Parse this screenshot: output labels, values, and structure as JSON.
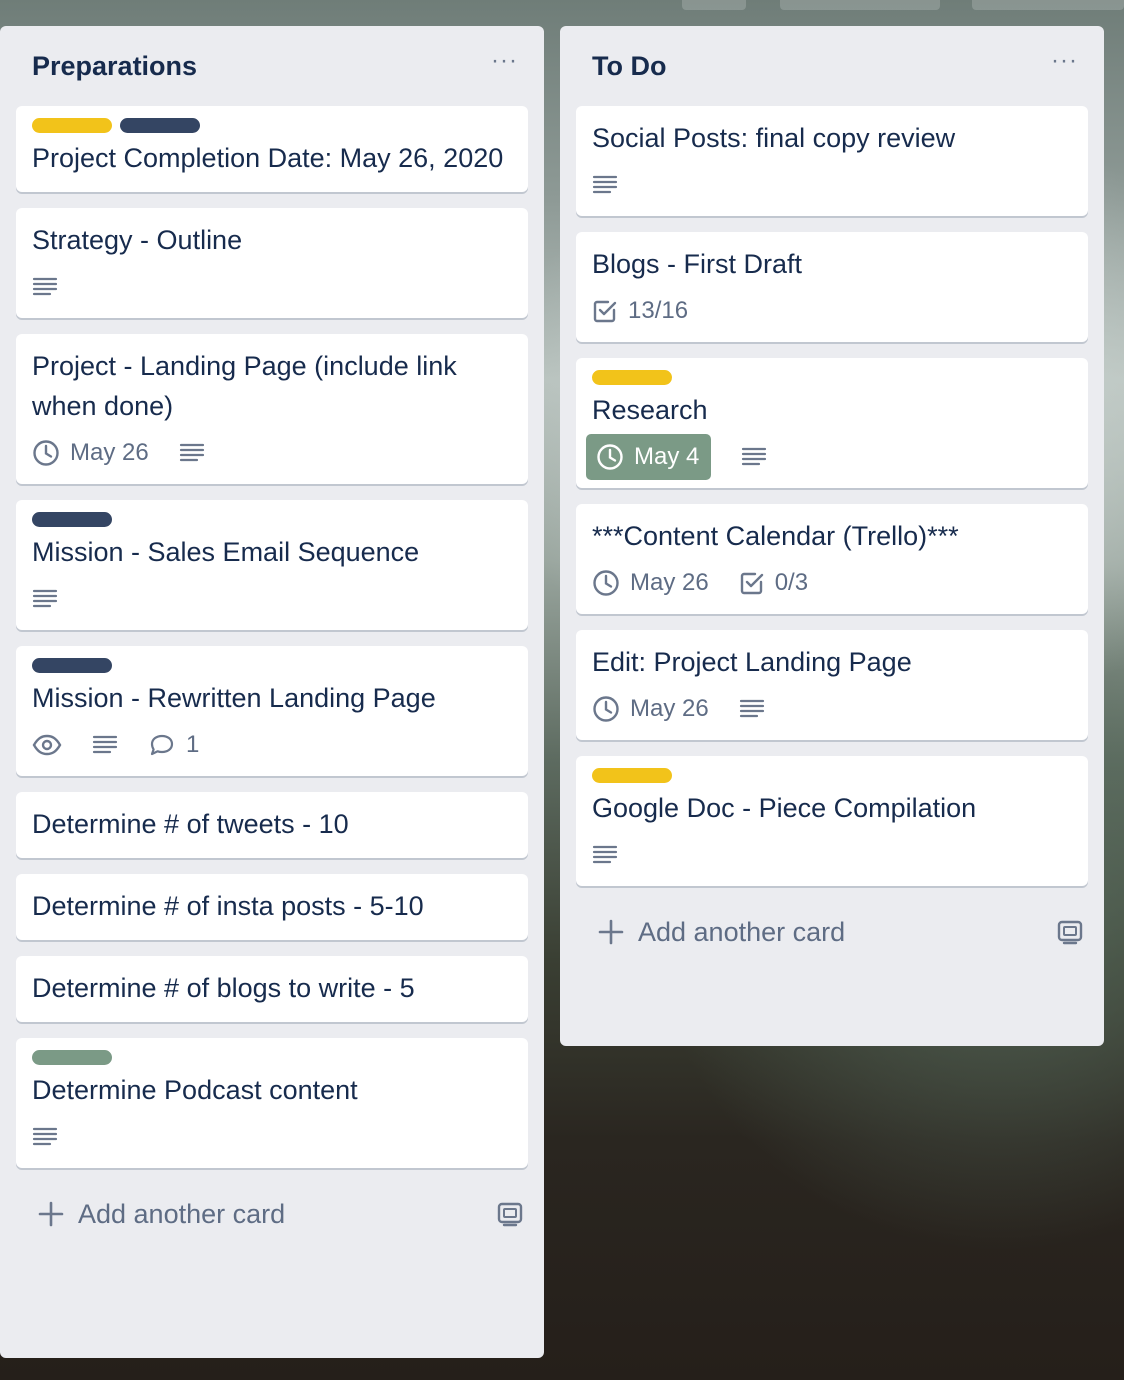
{
  "colors": {
    "label_yellow": "#f2c31a",
    "label_navy": "#344563",
    "label_gray": "#7b9a86",
    "list_bg": "#ebecf0",
    "card_bg": "#ffffff",
    "due_badge_bg": "#7b9a86"
  },
  "lists": [
    {
      "title": "Preparations",
      "menu": "···",
      "add_card_label": "Add another card",
      "cards": [
        {
          "labels": [
            "label_yellow",
            "label_navy"
          ],
          "title": "Project Completion Date: May 26, 2020",
          "badges": []
        },
        {
          "labels": [],
          "title": "Strategy - Outline",
          "badges": [
            {
              "icon": "description-icon"
            }
          ]
        },
        {
          "labels": [],
          "title": "Project - Landing Page (include link when done)",
          "badges": [
            {
              "icon": "clock-icon",
              "text": "May 26"
            },
            {
              "icon": "description-icon"
            }
          ]
        },
        {
          "labels": [
            "label_navy"
          ],
          "title": "Mission - Sales Email Sequence",
          "badges": [
            {
              "icon": "description-icon"
            }
          ]
        },
        {
          "labels": [
            "label_navy"
          ],
          "title": "Mission - Rewritten Landing Page",
          "badges": [
            {
              "icon": "eye-icon"
            },
            {
              "icon": "description-icon"
            },
            {
              "icon": "comment-icon",
              "text": "1"
            }
          ]
        },
        {
          "labels": [],
          "title": "Determine # of tweets - 10",
          "badges": []
        },
        {
          "labels": [],
          "title": "Determine # of insta posts - 5-10",
          "badges": []
        },
        {
          "labels": [],
          "title": "Determine # of blogs to write - 5",
          "badges": []
        },
        {
          "labels": [
            "label_gray"
          ],
          "title": "Determine Podcast content",
          "badges": [
            {
              "icon": "description-icon"
            }
          ]
        }
      ]
    },
    {
      "title": "To Do",
      "menu": "···",
      "add_card_label": "Add another card",
      "cards": [
        {
          "labels": [],
          "title": "Social Posts: final copy review",
          "badges": [
            {
              "icon": "description-icon"
            }
          ]
        },
        {
          "labels": [],
          "title": "Blogs - First Draft",
          "badges": [
            {
              "icon": "checklist-icon",
              "text": "13/16"
            }
          ]
        },
        {
          "labels": [
            "label_yellow"
          ],
          "title": "Research",
          "badges": [
            {
              "icon": "clock-icon",
              "text": "May 4",
              "highlight": true
            },
            {
              "icon": "description-icon"
            }
          ]
        },
        {
          "labels": [],
          "title": "***Content Calendar (Trello)***",
          "badges": [
            {
              "icon": "clock-icon",
              "text": "May 26"
            },
            {
              "icon": "checklist-icon",
              "text": "0/3"
            }
          ]
        },
        {
          "labels": [],
          "title": "Edit: Project Landing Page",
          "badges": [
            {
              "icon": "clock-icon",
              "text": "May 26"
            },
            {
              "icon": "description-icon"
            }
          ]
        },
        {
          "labels": [
            "label_yellow"
          ],
          "title": "Google Doc - Piece Compilation",
          "badges": [
            {
              "icon": "description-icon"
            }
          ]
        }
      ]
    }
  ]
}
